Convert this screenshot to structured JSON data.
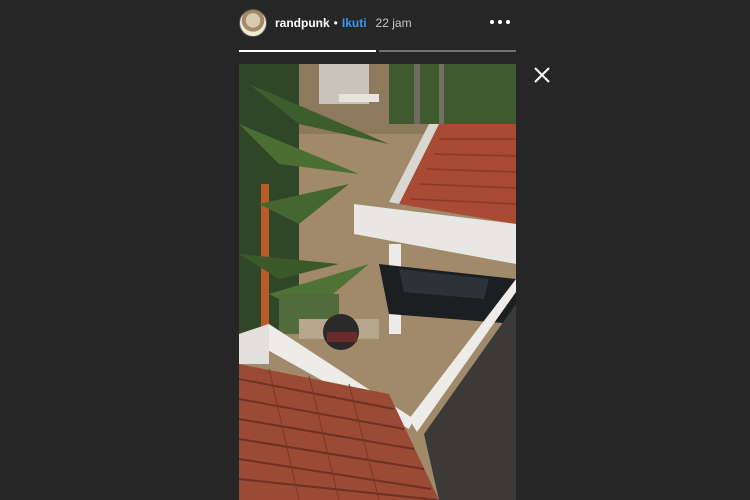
{
  "story": {
    "username": "randpunk",
    "separator": "•",
    "follow_label": "Ikuti",
    "timestamp": "22 jam",
    "progress": [
      1.0,
      0.0
    ]
  },
  "icons": {
    "avatar": "avatar",
    "more": "more-options-icon",
    "close": "close-icon"
  },
  "colors": {
    "background": "#262626",
    "follow": "#3897f0",
    "text": "#ffffff"
  }
}
